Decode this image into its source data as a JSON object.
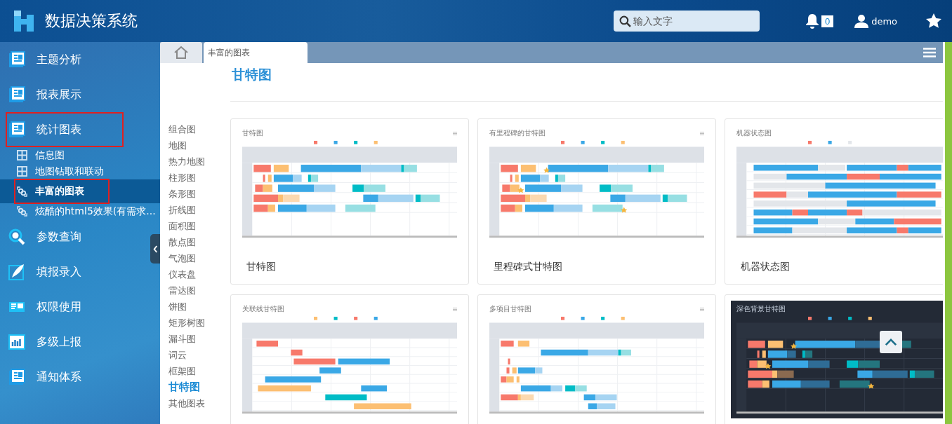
{
  "header": {
    "title": "数据决策系统",
    "search": {
      "placeholder": "输入文字"
    },
    "notifications": "0",
    "user": "demo"
  },
  "sidebar": {
    "items": [
      {
        "label": "主题分析",
        "kind": "doc",
        "highlighted": false
      },
      {
        "label": "报表展示",
        "kind": "doc",
        "highlighted": false
      },
      {
        "label": "统计图表",
        "kind": "doc",
        "highlighted": true,
        "children": [
          {
            "label": "信息图",
            "kind": "grid",
            "selected": false,
            "highlighted": false
          },
          {
            "label": "地图钻取和联动",
            "kind": "grid",
            "selected": false,
            "highlighted": false
          },
          {
            "label": "丰富的图表",
            "kind": "link",
            "selected": true,
            "highlighted": true
          },
          {
            "label": "炫酷的html5效果(有需求...",
            "kind": "link",
            "selected": false,
            "highlighted": false
          }
        ]
      },
      {
        "label": "参数查询",
        "kind": "search",
        "highlighted": false
      },
      {
        "label": "填报录入",
        "kind": "feather",
        "highlighted": false
      },
      {
        "label": "权限使用",
        "kind": "panel",
        "highlighted": false
      },
      {
        "label": "多级上报",
        "kind": "bars",
        "highlighted": false
      },
      {
        "label": "通知体系",
        "kind": "doc",
        "highlighted": false
      }
    ]
  },
  "tabs": [
    {
      "kind": "home",
      "selected": false
    },
    {
      "kind": "page",
      "label": "丰富的图表",
      "selected": true
    }
  ],
  "page_title": "甘特图",
  "categories": [
    {
      "label": "组合图",
      "selected": false
    },
    {
      "label": "地图",
      "selected": false
    },
    {
      "label": "热力地图",
      "selected": false
    },
    {
      "label": "柱形图",
      "selected": false
    },
    {
      "label": "条形图",
      "selected": false
    },
    {
      "label": "折线图",
      "selected": false
    },
    {
      "label": "面积图",
      "selected": false
    },
    {
      "label": "散点图",
      "selected": false
    },
    {
      "label": "气泡图",
      "selected": false
    },
    {
      "label": "仪表盘",
      "selected": false
    },
    {
      "label": "雷达图",
      "selected": false
    },
    {
      "label": "饼图",
      "selected": false
    },
    {
      "label": "矩形树图",
      "selected": false
    },
    {
      "label": "漏斗图",
      "selected": false
    },
    {
      "label": "词云",
      "selected": false
    },
    {
      "label": "框架图",
      "selected": false
    },
    {
      "label": "甘特图",
      "selected": true
    },
    {
      "label": "其他图表",
      "selected": false
    }
  ],
  "cards": [
    {
      "title": "甘特图",
      "caption": "甘特图",
      "kind": "basic"
    },
    {
      "title": "有里程碑的甘特图",
      "caption": "里程碑式甘特图",
      "kind": "milestone"
    },
    {
      "title": "机器状态图",
      "caption": "机器状态图",
      "kind": "machine"
    },
    {
      "title": "关联线甘特图",
      "kind": "linked"
    },
    {
      "title": "多项目甘特图",
      "kind": "multi"
    },
    {
      "title": "深色背景甘特图",
      "kind": "dark"
    }
  ]
}
